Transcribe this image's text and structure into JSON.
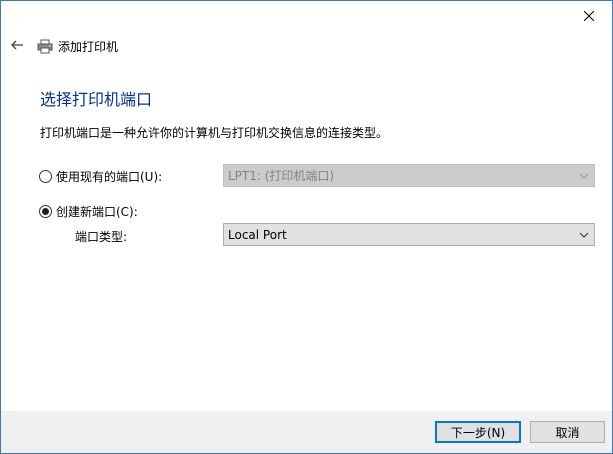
{
  "window": {
    "title": "添加打印机",
    "close_icon": "close-icon",
    "back_icon": "back-arrow-icon",
    "printer_icon": "printer-icon"
  },
  "main": {
    "heading": "选择打印机端口",
    "description": "打印机端口是一种允许你的计算机与打印机交换信息的连接类型。",
    "existing_port": {
      "label": "使用现有的端口(U):",
      "selected": false,
      "value": "LPT1: (打印机端口)",
      "enabled": false
    },
    "new_port": {
      "label": "创建新端口(C):",
      "selected": true,
      "type_label": "端口类型:",
      "value": "Local Port",
      "enabled": true
    }
  },
  "footer": {
    "next_label": "下一步(N)",
    "cancel_label": "取消"
  },
  "colors": {
    "heading": "#003399",
    "accent": "#0078d7",
    "window_border": "#3c78bd",
    "footer_bg": "#f0f0f0"
  }
}
